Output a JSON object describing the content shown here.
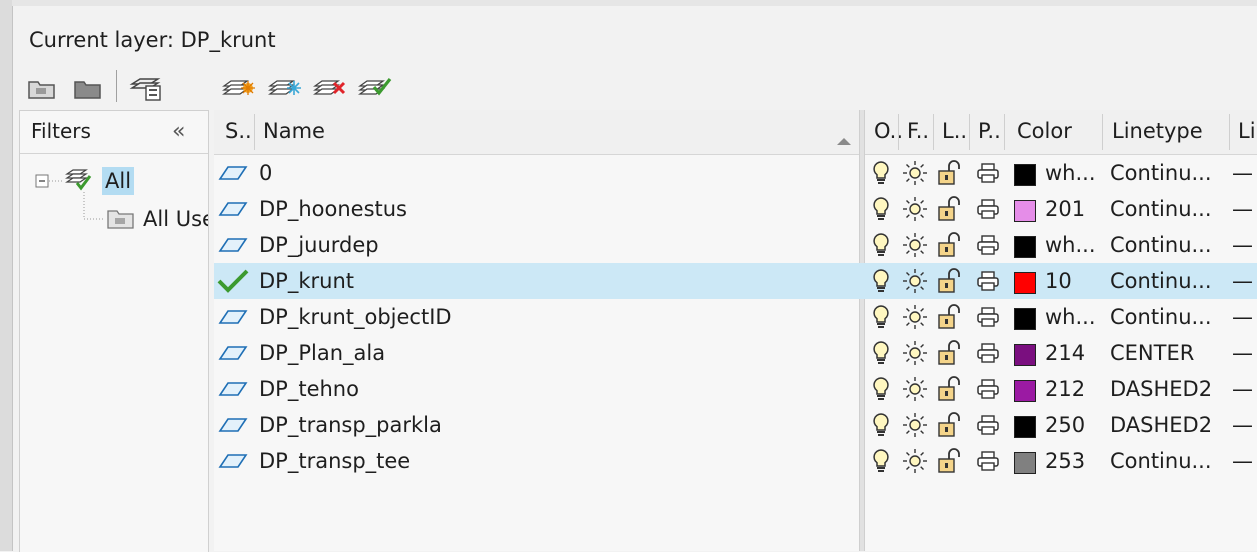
{
  "current_layer": {
    "label": "Current layer: DP_krunt"
  },
  "toolbar": {
    "left_icons": [
      "new-property-filter-icon",
      "new-group-filter-icon",
      "layer-states-manager-icon"
    ],
    "right_icons": [
      "new-layer-icon",
      "new-layer-vp-frozen-icon",
      "delete-layer-icon",
      "set-current-icon"
    ]
  },
  "filters": {
    "title": "Filters",
    "collapse": "«",
    "tree": {
      "all_label": "All",
      "all_used_label": "All Used Layers"
    }
  },
  "grid": {
    "columns": {
      "status": "S..",
      "name": "Name",
      "on": "O..",
      "freeze": "F..",
      "lock": "L..",
      "plot": "P..",
      "color": "Color",
      "linetype": "Linetype",
      "lineweight": "Li"
    },
    "rows": [
      {
        "name": "0",
        "status": "layer",
        "color_text": "wh...",
        "color_hex": "#000000",
        "linetype": "Continu...",
        "lineweight": "—"
      },
      {
        "name": "DP_hoonestus",
        "status": "layer",
        "color_text": "201",
        "color_hex": "#e58de8",
        "linetype": "Continu...",
        "lineweight": "—"
      },
      {
        "name": "DP_juurdep",
        "status": "layer",
        "color_text": "wh...",
        "color_hex": "#000000",
        "linetype": "Continu...",
        "lineweight": "—"
      },
      {
        "name": "DP_krunt",
        "status": "current",
        "color_text": "10",
        "color_hex": "#ff0000",
        "linetype": "Continu...",
        "lineweight": "—"
      },
      {
        "name": "DP_krunt_objectID",
        "status": "layer",
        "color_text": "wh...",
        "color_hex": "#000000",
        "linetype": "Continu...",
        "lineweight": "—"
      },
      {
        "name": "DP_Plan_ala",
        "status": "layer",
        "color_text": "214",
        "color_hex": "#7a0f7f",
        "linetype": "CENTER",
        "lineweight": "—"
      },
      {
        "name": "DP_tehno",
        "status": "layer",
        "color_text": "212",
        "color_hex": "#9b1aa3",
        "linetype": "DASHED2",
        "lineweight": "—"
      },
      {
        "name": "DP_transp_parkla",
        "status": "layer",
        "color_text": "250",
        "color_hex": "#000000",
        "linetype": "DASHED2",
        "lineweight": "—"
      },
      {
        "name": "DP_transp_tee",
        "status": "layer",
        "color_text": "253",
        "color_hex": "#808080",
        "linetype": "Continu...",
        "lineweight": "—"
      }
    ]
  },
  "colors": {
    "selected_row": "#cce8f6",
    "accent": "#0078d7"
  }
}
